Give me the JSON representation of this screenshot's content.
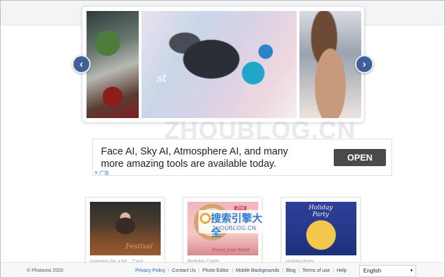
{
  "ad": {
    "headline": "Face AI, Sky AI, Atmosphere AI, and many more amazing tools are available today.",
    "cta": "OPEN",
    "marker": "✕ 广告"
  },
  "carousel": {
    "prev_glyph": "‹",
    "next_glyph": "›",
    "slide_text": "st"
  },
  "cards": [
    {
      "thumb_text": "Festival",
      "caption": "Invitation for a Fe... Card"
    },
    {
      "thumb_badge": "2nd",
      "thumb_text": "Emma June Smith",
      "caption": "Birthday Cards"
    },
    {
      "thumb_text": "Holiday Party",
      "caption": "Holiday Party"
    }
  ],
  "footer": {
    "copyright": "© Photovisi 2020",
    "links": [
      "Privacy Policy",
      "Contact Us",
      "Photo Editor",
      "Mobile Backgrounds",
      "Blog",
      "Terms of use",
      "Help"
    ],
    "language": "English"
  },
  "watermark": {
    "main": "ZHOUBLOG.CN",
    "cn": "搜索引擎大全",
    "url": "ZHOUBLOG.CN"
  }
}
